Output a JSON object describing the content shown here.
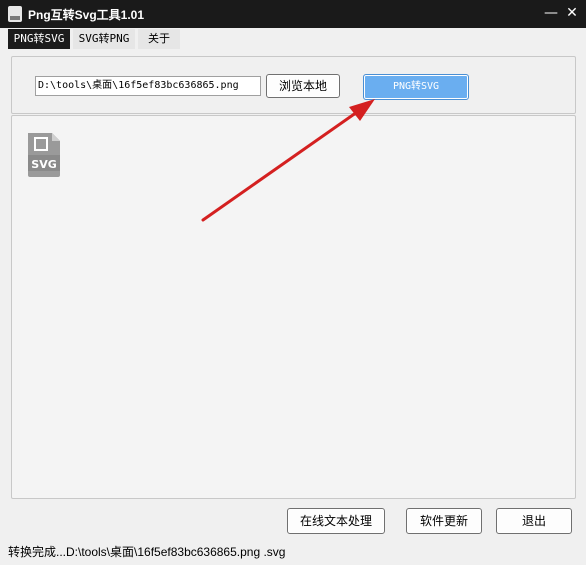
{
  "window": {
    "title": "Png互转Svg工具1.01",
    "minimize_label": "—",
    "close_label": "✕"
  },
  "tabs": [
    {
      "label": "PNG转SVG",
      "active": true
    },
    {
      "label": "SVG转PNG",
      "active": false
    },
    {
      "label": "关于",
      "active": false
    }
  ],
  "input": {
    "path_value": "D:\\tools\\桌面\\16f5ef83bc636865.png"
  },
  "buttons": {
    "browse": "浏览本地",
    "convert": "PNG转SVG",
    "online": "在线文本处理",
    "update": "软件更新",
    "exit": "退出"
  },
  "preview": {
    "file_icon_label": "SVG"
  },
  "status": {
    "text": "转换完成...D:\\tools\\桌面\\16f5ef83bc636865.png .svg"
  },
  "colors": {
    "titlebar": "#1a1a1a",
    "accent_button": "#6aaef0",
    "arrow": "#d42020"
  }
}
